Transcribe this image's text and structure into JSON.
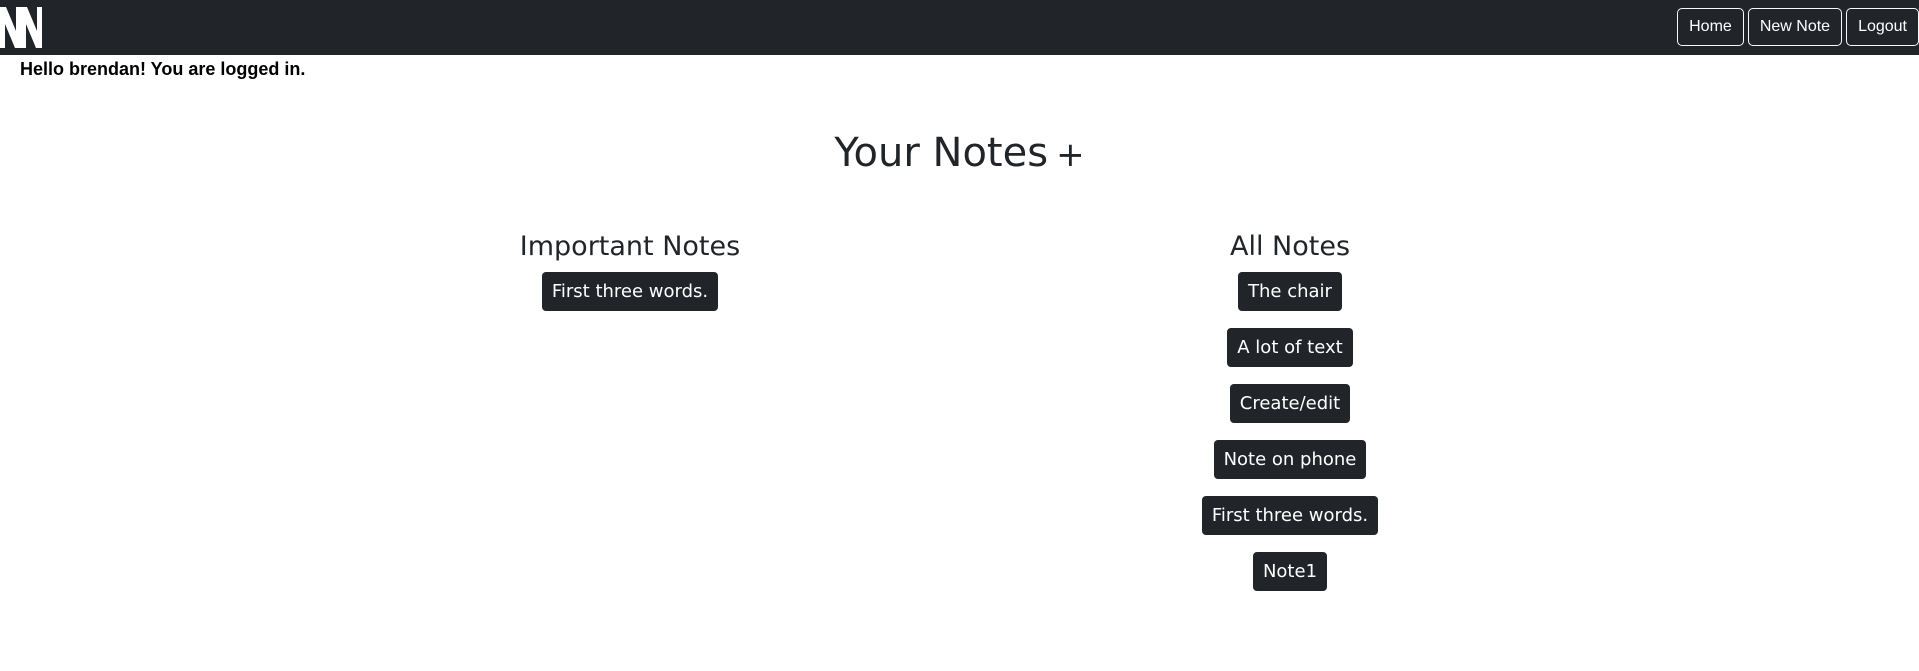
{
  "nav": {
    "logo": "NN",
    "buttons": [
      {
        "label": "Home"
      },
      {
        "label": "New Note"
      },
      {
        "label": "Logout"
      }
    ]
  },
  "greeting": "Hello brendan! You are logged in.",
  "page_title": "Your Notes",
  "add_symbol": "+",
  "important": {
    "heading": "Important Notes",
    "notes": [
      "First three words."
    ]
  },
  "all": {
    "heading": "All Notes",
    "notes": [
      "The chair",
      "A lot of text",
      "Create/edit",
      "Note on phone",
      "First three words.",
      "Note1"
    ]
  },
  "colors": {
    "navbar": "#212529",
    "note_button": "#212529",
    "text": "#212529"
  }
}
